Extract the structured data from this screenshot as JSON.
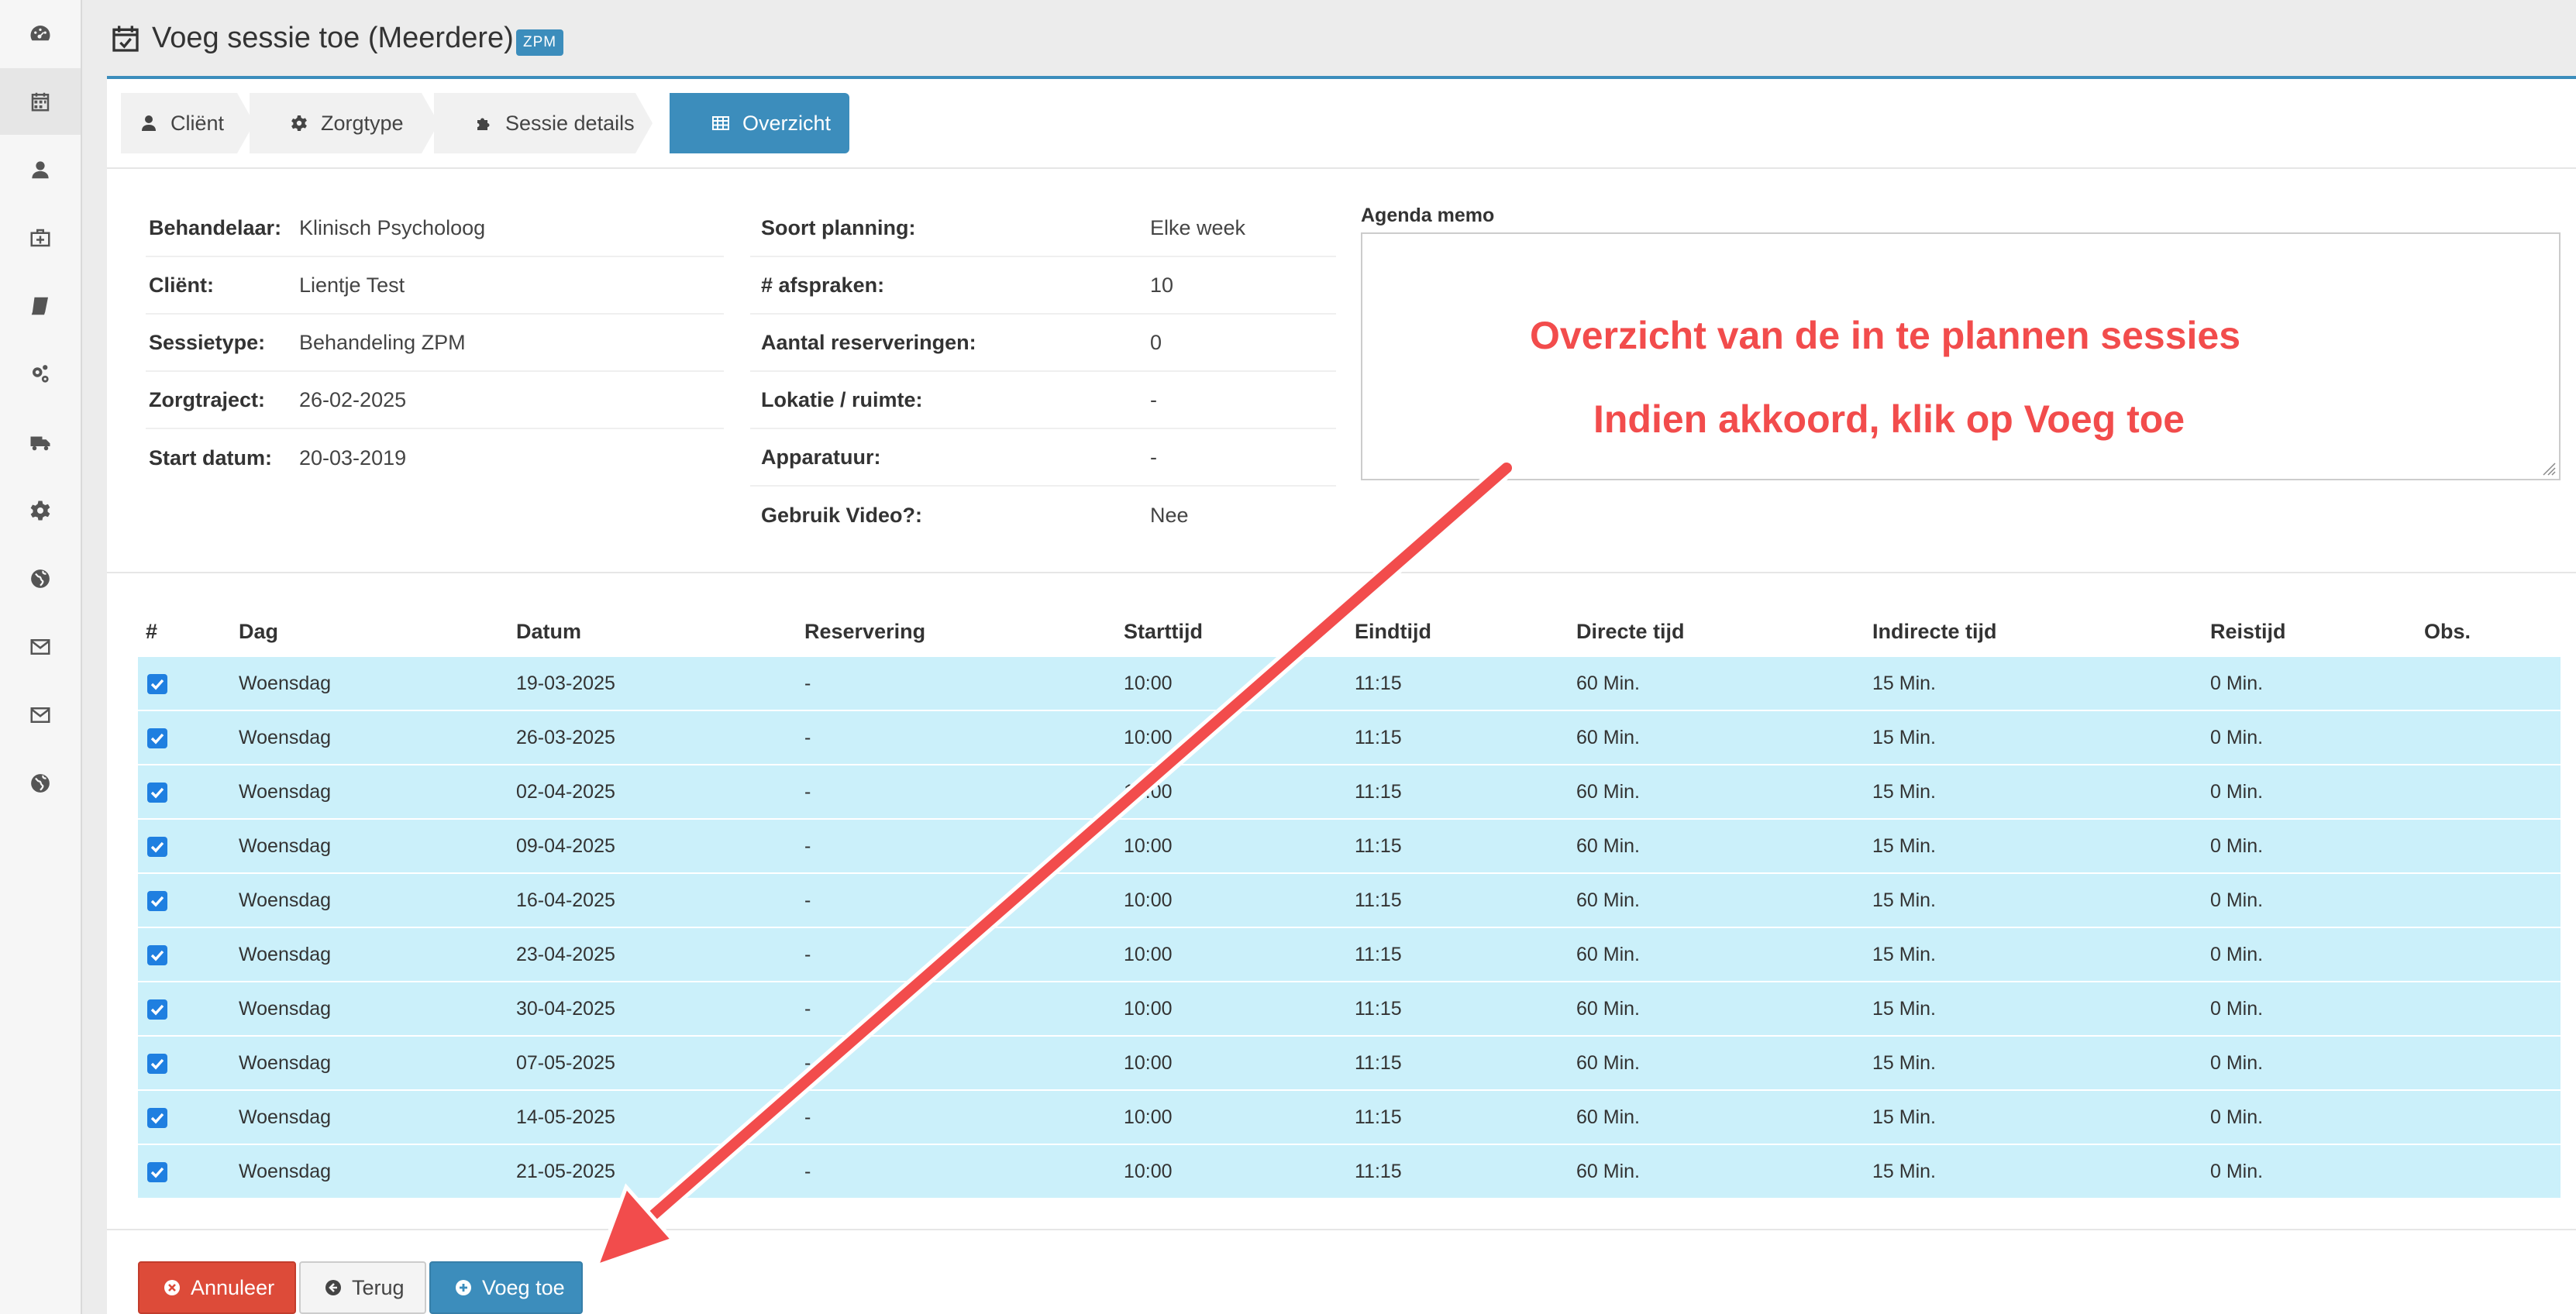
{
  "header": {
    "title": "Voeg sessie toe (Meerdere)",
    "badge": "ZPM"
  },
  "steps": [
    {
      "label": "Cliënt",
      "icon": "user-icon"
    },
    {
      "label": "Zorgtype",
      "icon": "gear-icon"
    },
    {
      "label": "Sessie details",
      "icon": "puzzle-icon"
    },
    {
      "label": "Overzicht",
      "icon": "table-icon",
      "active": true
    }
  ],
  "info_left": [
    {
      "label": "Behandelaar:",
      "value": "Klinisch Psycholoog"
    },
    {
      "label": "Cliënt:",
      "value": "Lientje Test"
    },
    {
      "label": "Sessietype:",
      "value": "Behandeling ZPM"
    },
    {
      "label": "Zorgtraject:",
      "value": "26-02-2025"
    },
    {
      "label": "Start datum:",
      "value": "20-03-2019"
    }
  ],
  "info_right": [
    {
      "label": "Soort planning:",
      "value": "Elke week"
    },
    {
      "label": "# afspraken:",
      "value": "10"
    },
    {
      "label": "Aantal reserveringen:",
      "value": "0"
    },
    {
      "label": "Lokatie / ruimte:",
      "value": "-"
    },
    {
      "label": "Apparatuur:",
      "value": "-"
    },
    {
      "label": "Gebruik Video?:",
      "value": "Nee"
    }
  ],
  "memo": {
    "label": "Agenda memo"
  },
  "table": {
    "columns": [
      "#",
      "Dag",
      "Datum",
      "Reservering",
      "Starttijd",
      "Eindtijd",
      "Directe tijd",
      "Indirecte tijd",
      "Reistijd",
      "Obs."
    ],
    "rows": [
      {
        "dag": "Woensdag",
        "datum": "19-03-2025",
        "reservering": "-",
        "start": "10:00",
        "eind": "11:15",
        "direct": "60 Min.",
        "indirect": "15 Min.",
        "reis": "0 Min."
      },
      {
        "dag": "Woensdag",
        "datum": "26-03-2025",
        "reservering": "-",
        "start": "10:00",
        "eind": "11:15",
        "direct": "60 Min.",
        "indirect": "15 Min.",
        "reis": "0 Min."
      },
      {
        "dag": "Woensdag",
        "datum": "02-04-2025",
        "reservering": "-",
        "start": "10:00",
        "eind": "11:15",
        "direct": "60 Min.",
        "indirect": "15 Min.",
        "reis": "0 Min."
      },
      {
        "dag": "Woensdag",
        "datum": "09-04-2025",
        "reservering": "-",
        "start": "10:00",
        "eind": "11:15",
        "direct": "60 Min.",
        "indirect": "15 Min.",
        "reis": "0 Min."
      },
      {
        "dag": "Woensdag",
        "datum": "16-04-2025",
        "reservering": "-",
        "start": "10:00",
        "eind": "11:15",
        "direct": "60 Min.",
        "indirect": "15 Min.",
        "reis": "0 Min."
      },
      {
        "dag": "Woensdag",
        "datum": "23-04-2025",
        "reservering": "-",
        "start": "10:00",
        "eind": "11:15",
        "direct": "60 Min.",
        "indirect": "15 Min.",
        "reis": "0 Min."
      },
      {
        "dag": "Woensdag",
        "datum": "30-04-2025",
        "reservering": "-",
        "start": "10:00",
        "eind": "11:15",
        "direct": "60 Min.",
        "indirect": "15 Min.",
        "reis": "0 Min."
      },
      {
        "dag": "Woensdag",
        "datum": "07-05-2025",
        "reservering": "-",
        "start": "10:00",
        "eind": "11:15",
        "direct": "60 Min.",
        "indirect": "15 Min.",
        "reis": "0 Min."
      },
      {
        "dag": "Woensdag",
        "datum": "14-05-2025",
        "reservering": "-",
        "start": "10:00",
        "eind": "11:15",
        "direct": "60 Min.",
        "indirect": "15 Min.",
        "reis": "0 Min."
      },
      {
        "dag": "Woensdag",
        "datum": "21-05-2025",
        "reservering": "-",
        "start": "10:00",
        "eind": "11:15",
        "direct": "60 Min.",
        "indirect": "15 Min.",
        "reis": "0 Min."
      }
    ]
  },
  "buttons": {
    "cancel": "Annuleer",
    "back": "Terug",
    "add": "Voeg toe"
  },
  "annotation": {
    "line1": "Overzicht van de in te plannen sessies",
    "line2": "Indien akkoord, klik op Voeg toe",
    "color": "#f24c4c"
  },
  "colors": {
    "primary": "#3c8dbc",
    "danger": "#dd4b39",
    "row_bg": "#cbf0fa",
    "checkbox": "#1f7fe0"
  }
}
